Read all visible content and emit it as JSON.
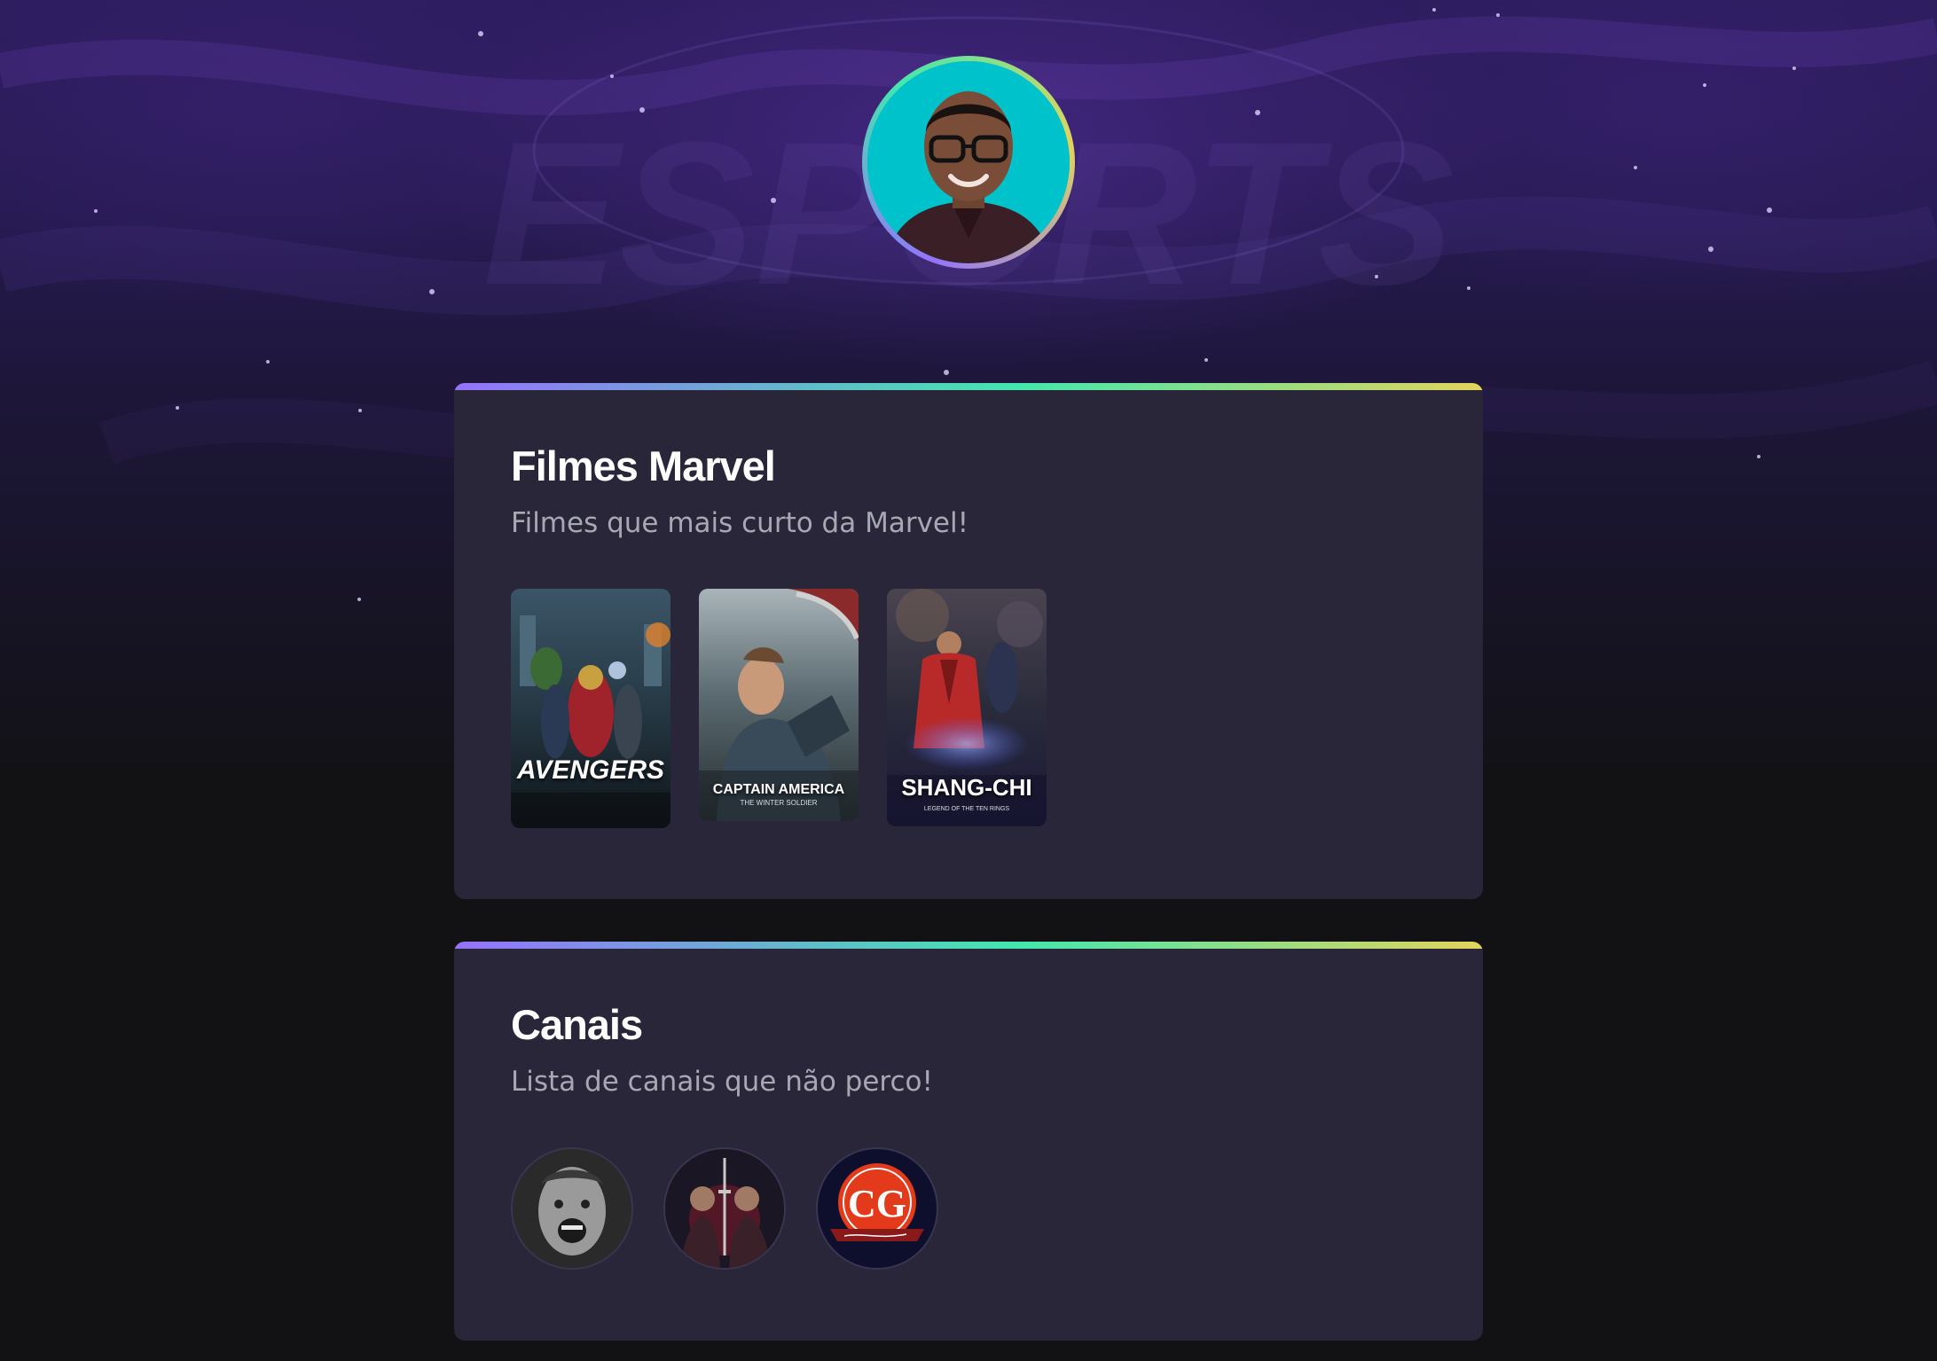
{
  "profile": {
    "avatar_icon": "profile-photo",
    "ring_colors": [
      "#9572fc",
      "#43e7ad",
      "#e2d45c"
    ]
  },
  "background": {
    "watermark_text": "ESPORTS"
  },
  "sections": [
    {
      "title": "Filmes Marvel",
      "subtitle": "Filmes que mais curto da Marvel!",
      "items": [
        {
          "name": "avengers-poster",
          "label": "AVENGERS"
        },
        {
          "name": "captain-america-poster",
          "label": "CAPTAIN AMERICA",
          "sub": "THE WINTER SOLDIER"
        },
        {
          "name": "shang-chi-poster",
          "label": "SHANG-CHI",
          "sub": "LEGEND OF THE TEN RINGS"
        }
      ]
    },
    {
      "title": "Canais",
      "subtitle": "Lista de canais que não perco!",
      "items": [
        {
          "name": "channel-avatar-1"
        },
        {
          "name": "channel-avatar-2"
        },
        {
          "name": "channel-avatar-3",
          "label": "CG"
        }
      ]
    }
  ],
  "colors": {
    "card_bg": "#29263a",
    "page_bg": "#121214",
    "title": "#ffffff",
    "subtitle": "#a8a8b3"
  }
}
